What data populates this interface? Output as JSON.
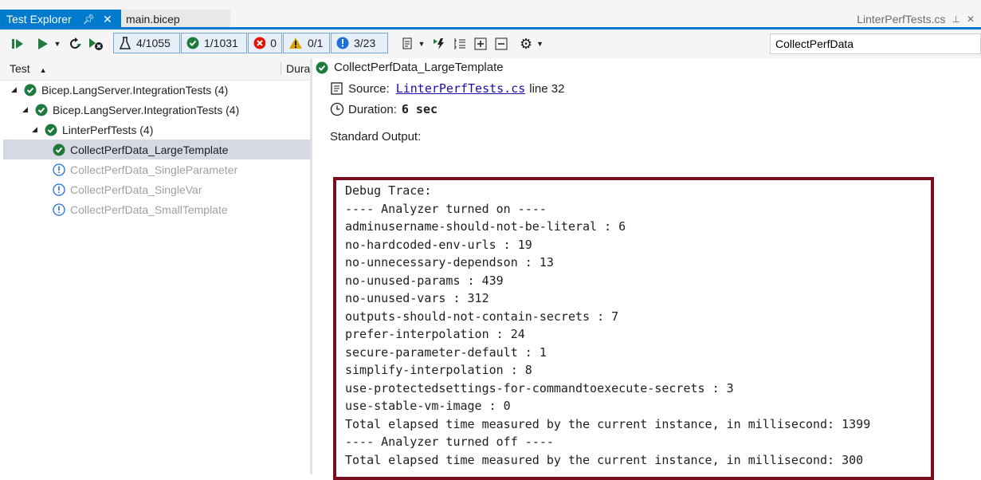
{
  "tabs": {
    "active": "Test Explorer",
    "file": "main.bicep",
    "right_file": "LinterPerfTests.cs"
  },
  "toolbar": {
    "filters": {
      "total": "4/1055",
      "passed": "1/1031",
      "failed": "0",
      "warnings": "0/1",
      "info": "3/23"
    },
    "search_value": "CollectPerfData"
  },
  "tree": {
    "col_test": "Test",
    "col_duration": "Duration",
    "rows": [
      {
        "label": "Bicep.LangServer.IntegrationTests  (4)"
      },
      {
        "label": "Bicep.LangServer.IntegrationTests  (4)"
      },
      {
        "label": "LinterPerfTests  (4)"
      },
      {
        "label": "CollectPerfData_LargeTemplate"
      },
      {
        "label": "CollectPerfData_SingleParameter"
      },
      {
        "label": "CollectPerfData_SingleVar"
      },
      {
        "label": "CollectPerfData_SmallTemplate"
      }
    ]
  },
  "details": {
    "title": "CollectPerfData_LargeTemplate",
    "source_label": "Source:",
    "source_file": "LinterPerfTests.cs",
    "source_line": "line 32",
    "duration_label": "Duration:",
    "duration_value": "6 sec",
    "stdout_label": "Standard Output:",
    "trace_lines": [
      "Debug Trace:",
      "---- Analyzer turned on ----",
      "adminusername-should-not-be-literal : 6",
      "no-hardcoded-env-urls : 19",
      "no-unnecessary-dependson : 13",
      "no-unused-params : 439",
      "no-unused-vars : 312",
      "outputs-should-not-contain-secrets : 7",
      "prefer-interpolation : 24",
      "secure-parameter-default : 1",
      "simplify-interpolation : 8",
      "use-protectedsettings-for-commandtoexecute-secrets : 3",
      "use-stable-vm-image : 0",
      "Total elapsed time measured by the current instance, in millisecond: 1399",
      "---- Analyzer turned off ----",
      "Total elapsed time measured by the current instance, in millisecond: 300"
    ]
  },
  "colors": {
    "accent": "#007acc",
    "pass": "#1f7a3e",
    "fail": "#e51400",
    "warn": "#d8a200",
    "info": "#1e6fd9",
    "trace_border": "#7b0e1c"
  }
}
